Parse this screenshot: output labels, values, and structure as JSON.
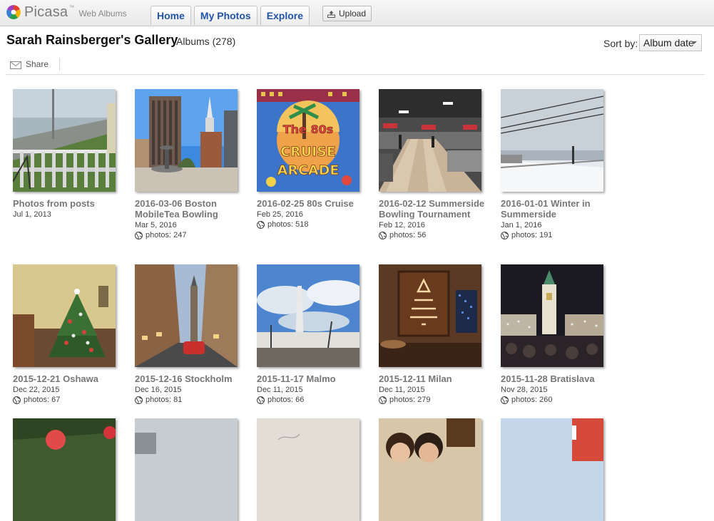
{
  "app": {
    "logo_text": "Picasa",
    "logo_tm": "™",
    "logo_subtitle": "Web Albums"
  },
  "nav": {
    "tabs": [
      {
        "label": "Home"
      },
      {
        "label": "My Photos"
      },
      {
        "label": "Explore"
      }
    ],
    "upload_label": "Upload"
  },
  "header": {
    "title": "Sarah Rainsberger's Gallery",
    "album_count": "Albums (278)",
    "sort_label": "Sort by:",
    "sort_value": "Album date"
  },
  "toolbar": {
    "share_label": "Share"
  },
  "albums": [
    {
      "title": "Photos from posts",
      "date": "Jul 1, 2013",
      "photos": ""
    },
    {
      "title": "2016-03-06 Boston MobileTea Bowling",
      "date": "Mar 5, 2016",
      "photos": "photos: 247"
    },
    {
      "title": "2016-02-25 80s Cruise",
      "date": "Feb 25, 2016",
      "photos": "photos: 518"
    },
    {
      "title": "2016-02-12 Summerside Bowling Tournament",
      "date": "Feb 12, 2016",
      "photos": "photos: 56"
    },
    {
      "title": "2016-01-01 Winter in Summerside",
      "date": "Jan 1, 2016",
      "photos": "photos: 191"
    },
    {
      "title": "2015-12-21 Oshawa",
      "date": "Dec 22, 2015",
      "photos": "photos: 67"
    },
    {
      "title": "2015-12-16 Stockholm",
      "date": "Dec 16, 2015",
      "photos": "photos: 81"
    },
    {
      "title": "2015-11-17 Malmo",
      "date": "Dec 11, 2015",
      "photos": "photos: 66"
    },
    {
      "title": "2015-12-11 Milan",
      "date": "Dec 11, 2015",
      "photos": "photos: 279"
    },
    {
      "title": "2015-11-28 Bratislava",
      "date": "Nov 28, 2015",
      "photos": "photos: 260"
    }
  ],
  "thumb_logo_text": {
    "line1": "The 80s",
    "line2": "CRUISE",
    "line3": "ARCADE"
  }
}
